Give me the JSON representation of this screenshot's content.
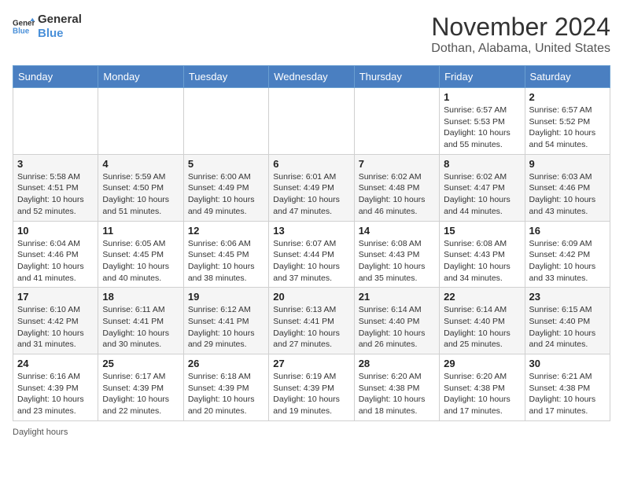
{
  "header": {
    "logo_line1": "General",
    "logo_line2": "Blue",
    "month_title": "November 2024",
    "location": "Dothan, Alabama, United States"
  },
  "days_of_week": [
    "Sunday",
    "Monday",
    "Tuesday",
    "Wednesday",
    "Thursday",
    "Friday",
    "Saturday"
  ],
  "weeks": [
    [
      {
        "day": "",
        "info": ""
      },
      {
        "day": "",
        "info": ""
      },
      {
        "day": "",
        "info": ""
      },
      {
        "day": "",
        "info": ""
      },
      {
        "day": "",
        "info": ""
      },
      {
        "day": "1",
        "info": "Sunrise: 6:57 AM\nSunset: 5:53 PM\nDaylight: 10 hours and 55 minutes."
      },
      {
        "day": "2",
        "info": "Sunrise: 6:57 AM\nSunset: 5:52 PM\nDaylight: 10 hours and 54 minutes."
      }
    ],
    [
      {
        "day": "3",
        "info": "Sunrise: 5:58 AM\nSunset: 4:51 PM\nDaylight: 10 hours and 52 minutes."
      },
      {
        "day": "4",
        "info": "Sunrise: 5:59 AM\nSunset: 4:50 PM\nDaylight: 10 hours and 51 minutes."
      },
      {
        "day": "5",
        "info": "Sunrise: 6:00 AM\nSunset: 4:49 PM\nDaylight: 10 hours and 49 minutes."
      },
      {
        "day": "6",
        "info": "Sunrise: 6:01 AM\nSunset: 4:49 PM\nDaylight: 10 hours and 47 minutes."
      },
      {
        "day": "7",
        "info": "Sunrise: 6:02 AM\nSunset: 4:48 PM\nDaylight: 10 hours and 46 minutes."
      },
      {
        "day": "8",
        "info": "Sunrise: 6:02 AM\nSunset: 4:47 PM\nDaylight: 10 hours and 44 minutes."
      },
      {
        "day": "9",
        "info": "Sunrise: 6:03 AM\nSunset: 4:46 PM\nDaylight: 10 hours and 43 minutes."
      }
    ],
    [
      {
        "day": "10",
        "info": "Sunrise: 6:04 AM\nSunset: 4:46 PM\nDaylight: 10 hours and 41 minutes."
      },
      {
        "day": "11",
        "info": "Sunrise: 6:05 AM\nSunset: 4:45 PM\nDaylight: 10 hours and 40 minutes."
      },
      {
        "day": "12",
        "info": "Sunrise: 6:06 AM\nSunset: 4:45 PM\nDaylight: 10 hours and 38 minutes."
      },
      {
        "day": "13",
        "info": "Sunrise: 6:07 AM\nSunset: 4:44 PM\nDaylight: 10 hours and 37 minutes."
      },
      {
        "day": "14",
        "info": "Sunrise: 6:08 AM\nSunset: 4:43 PM\nDaylight: 10 hours and 35 minutes."
      },
      {
        "day": "15",
        "info": "Sunrise: 6:08 AM\nSunset: 4:43 PM\nDaylight: 10 hours and 34 minutes."
      },
      {
        "day": "16",
        "info": "Sunrise: 6:09 AM\nSunset: 4:42 PM\nDaylight: 10 hours and 33 minutes."
      }
    ],
    [
      {
        "day": "17",
        "info": "Sunrise: 6:10 AM\nSunset: 4:42 PM\nDaylight: 10 hours and 31 minutes."
      },
      {
        "day": "18",
        "info": "Sunrise: 6:11 AM\nSunset: 4:41 PM\nDaylight: 10 hours and 30 minutes."
      },
      {
        "day": "19",
        "info": "Sunrise: 6:12 AM\nSunset: 4:41 PM\nDaylight: 10 hours and 29 minutes."
      },
      {
        "day": "20",
        "info": "Sunrise: 6:13 AM\nSunset: 4:41 PM\nDaylight: 10 hours and 27 minutes."
      },
      {
        "day": "21",
        "info": "Sunrise: 6:14 AM\nSunset: 4:40 PM\nDaylight: 10 hours and 26 minutes."
      },
      {
        "day": "22",
        "info": "Sunrise: 6:14 AM\nSunset: 4:40 PM\nDaylight: 10 hours and 25 minutes."
      },
      {
        "day": "23",
        "info": "Sunrise: 6:15 AM\nSunset: 4:40 PM\nDaylight: 10 hours and 24 minutes."
      }
    ],
    [
      {
        "day": "24",
        "info": "Sunrise: 6:16 AM\nSunset: 4:39 PM\nDaylight: 10 hours and 23 minutes."
      },
      {
        "day": "25",
        "info": "Sunrise: 6:17 AM\nSunset: 4:39 PM\nDaylight: 10 hours and 22 minutes."
      },
      {
        "day": "26",
        "info": "Sunrise: 6:18 AM\nSunset: 4:39 PM\nDaylight: 10 hours and 20 minutes."
      },
      {
        "day": "27",
        "info": "Sunrise: 6:19 AM\nSunset: 4:39 PM\nDaylight: 10 hours and 19 minutes."
      },
      {
        "day": "28",
        "info": "Sunrise: 6:20 AM\nSunset: 4:38 PM\nDaylight: 10 hours and 18 minutes."
      },
      {
        "day": "29",
        "info": "Sunrise: 6:20 AM\nSunset: 4:38 PM\nDaylight: 10 hours and 17 minutes."
      },
      {
        "day": "30",
        "info": "Sunrise: 6:21 AM\nSunset: 4:38 PM\nDaylight: 10 hours and 17 minutes."
      }
    ]
  ],
  "footer": {
    "daylight_label": "Daylight hours"
  }
}
